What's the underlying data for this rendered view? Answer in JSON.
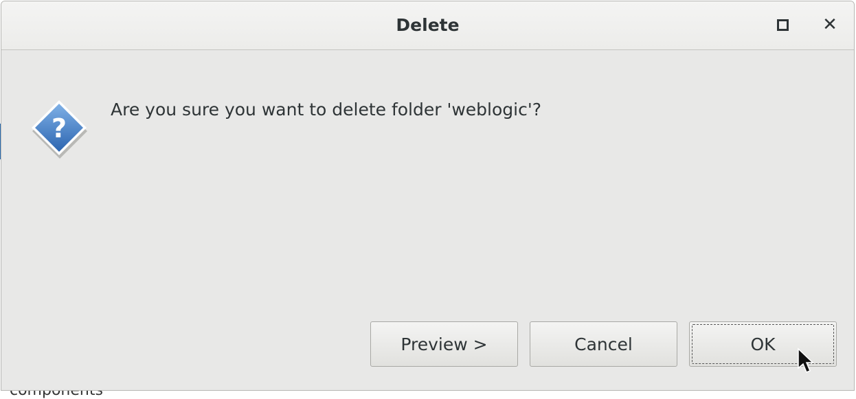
{
  "background": {
    "partial_text": "components"
  },
  "dialog": {
    "title": "Delete",
    "maximize_icon": "maximize-icon",
    "close_icon": "close-icon",
    "dialog_icon": "question-icon",
    "message": "Are you sure you want to delete folder 'weblogic'?",
    "buttons": {
      "preview": "Preview >",
      "cancel": "Cancel",
      "ok": "OK"
    },
    "colors": {
      "icon_blue": "#3a78c4",
      "surface": "#e8e8e7"
    }
  }
}
